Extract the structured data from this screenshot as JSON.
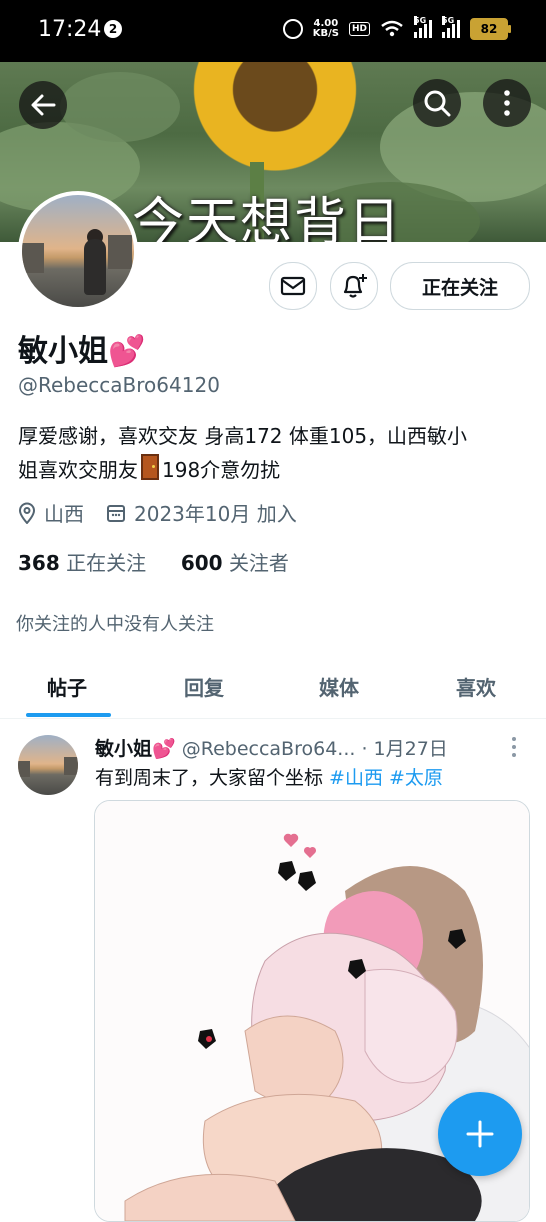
{
  "status_bar": {
    "time": "17:24",
    "notification_count": "2",
    "net_speed_value": "4.00",
    "net_speed_unit": "KB/S",
    "hd_label": "HD",
    "sim1": "5G",
    "sim2": "5G",
    "battery": "82"
  },
  "banner": {
    "text": "今天想背日"
  },
  "profile": {
    "name": "敏小姐",
    "name_emoji": "💕",
    "handle": "@RebeccaBro64120",
    "bio_line1": "厚爱感谢，喜欢交友 身高172 体重105，山西敏小",
    "bio_line2_before": "姐喜欢交朋友",
    "bio_line2_after": "198介意勿扰",
    "location": "山西",
    "joined": "2023年10月 加入",
    "following_count": "368",
    "following_label": "正在关注",
    "followers_count": "600",
    "followers_label": "关注者",
    "follow_button": "正在关注",
    "no_mutuals": "你关注的人中没有人关注"
  },
  "tabs": [
    "帖子",
    "回复",
    "媒体",
    "喜欢"
  ],
  "post": {
    "name": "敏小姐",
    "emoji": "💕",
    "handle": "@RebeccaBro64...",
    "date": "· 1月27日",
    "text": "有到周末了，大家留个坐标 ",
    "tags": [
      "#山西",
      "#太原"
    ]
  },
  "colors": {
    "accent": "#1d9bf0",
    "secondary_text": "#536471",
    "border": "#cfd9de"
  }
}
